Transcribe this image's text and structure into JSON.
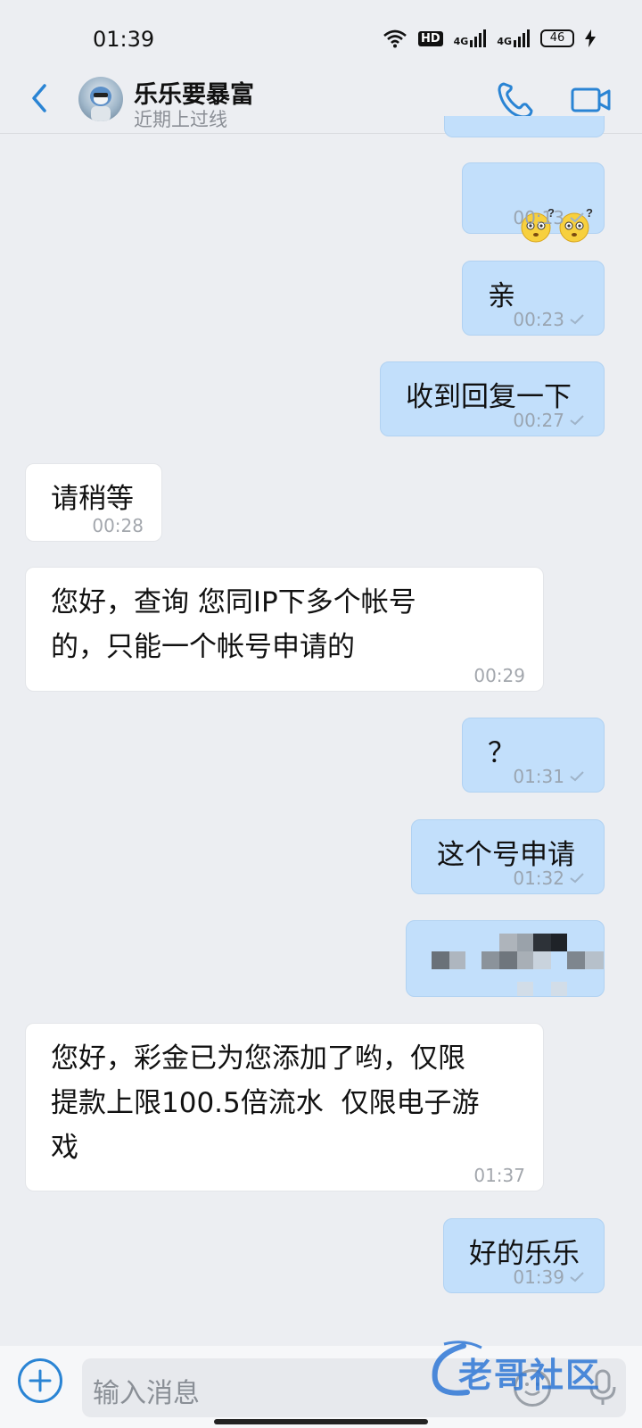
{
  "status_bar": {
    "time": "01:39",
    "hd_label": "HD",
    "net1": "4G",
    "net2": "4G",
    "battery": "46"
  },
  "header": {
    "contact_name": "乐乐要暴富",
    "contact_status": "近期上过线",
    "accent_color": "#2a84d4"
  },
  "messages": [
    {
      "side": "me",
      "text": "😳?😳?",
      "time": "00:13"
    },
    {
      "side": "me",
      "text": "亲",
      "time": "00:23"
    },
    {
      "side": "me",
      "text": "收到回复一下",
      "time": "00:27"
    },
    {
      "side": "them",
      "text": "请稍等",
      "time": "00:28"
    },
    {
      "side": "them",
      "text": "您好，查询 您同IP下多个帐号\n的，只能一个帐号申请的",
      "time": "00:29"
    },
    {
      "side": "me",
      "text": "？",
      "time": "01:31"
    },
    {
      "side": "me",
      "text": "这个号申请",
      "time": "01:32"
    },
    {
      "side": "me",
      "text": "",
      "time": "",
      "blurred": true
    },
    {
      "side": "them",
      "text": "您好，彩金已为您添加了哟，仅限\n提款上限100.5倍流水  仅限电子游\n戏",
      "time": "01:37"
    },
    {
      "side": "me",
      "text": "好的乐乐",
      "time": "01:39"
    }
  ],
  "composer": {
    "placeholder": "输入消息"
  },
  "watermark": {
    "text": "老哥社区"
  }
}
